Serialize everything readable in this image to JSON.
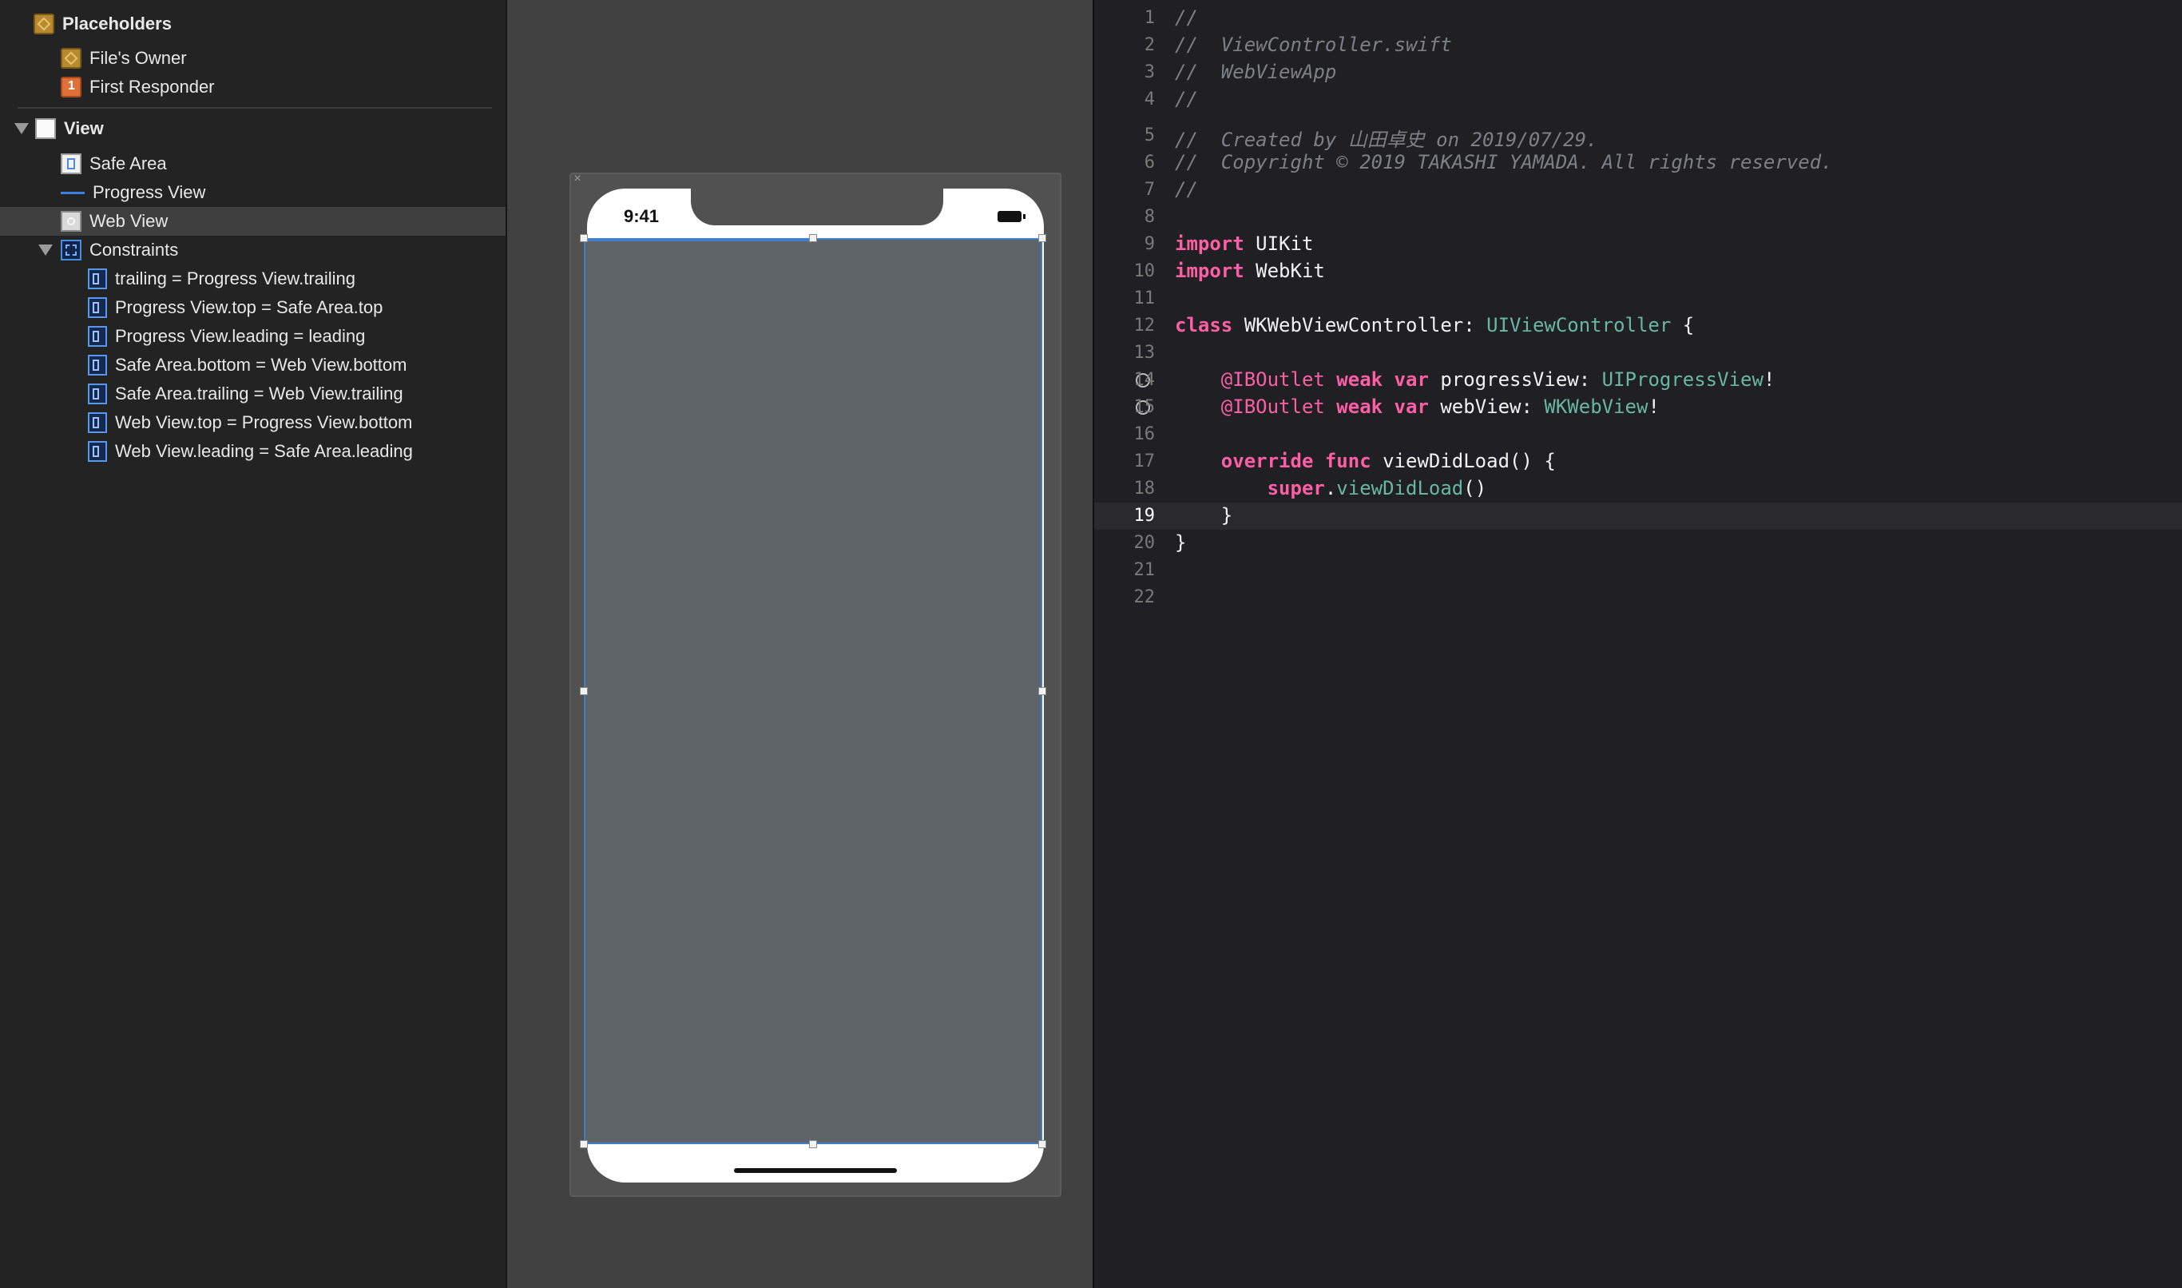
{
  "outline": {
    "placeholders_header": "Placeholders",
    "files_owner": "File's Owner",
    "first_responder": "First Responder",
    "view": "View",
    "safe_area": "Safe Area",
    "progress_view": "Progress View",
    "web_view": "Web View",
    "constraints_header": "Constraints",
    "constraints": [
      "trailing = Progress View.trailing",
      "Progress View.top = Safe Area.top",
      "Progress View.leading = leading",
      "Safe Area.bottom = Web View.bottom",
      "Safe Area.trailing = Web View.trailing",
      "Web View.top = Progress View.bottom",
      "Web View.leading = Safe Area.leading"
    ],
    "selected": "Web View"
  },
  "canvas": {
    "status_time": "9:41",
    "progress_fraction": 0.5
  },
  "editor": {
    "current_line": 19,
    "line_numbers": [
      "1",
      "2",
      "3",
      "4",
      "5",
      "6",
      "7",
      "8",
      "9",
      "10",
      "11",
      "12",
      "13",
      "14",
      "15",
      "16",
      "17",
      "18",
      "19",
      "20",
      "21",
      "22"
    ],
    "lines": {
      "l1": "//",
      "l2": "//  ViewController.swift",
      "l3": "//  WebViewApp",
      "l4": "//",
      "l5": "//  Created by 山田卓史 on 2019/07/29.",
      "l6": "//  Copyright © 2019 TAKASHI YAMADA. All rights reserved.",
      "l7": "//",
      "l9_kw": "import",
      "l9_rest": " UIKit",
      "l10_kw": "import",
      "l10_rest": " WebKit",
      "l12_kw": "class",
      "l12_name": " WKWebViewController: ",
      "l12_super": "UIViewController",
      "l12_brace": " {",
      "l14_attr": "@IBOutlet",
      "l14_kw": " weak var",
      "l14_name": " progressView: ",
      "l14_type": "UIProgressView",
      "l14_end": "!",
      "l15_attr": "@IBOutlet",
      "l15_kw": " weak var",
      "l15_name": " webView: ",
      "l15_type": "WKWebView",
      "l15_end": "!",
      "l17_kw": "override func",
      "l17_rest": " viewDidLoad() {",
      "l18_kw": "super",
      "l18_dot": ".",
      "l18_fn": "viewDidLoad",
      "l18_rest": "()",
      "l19": "}",
      "l20": "}"
    }
  }
}
